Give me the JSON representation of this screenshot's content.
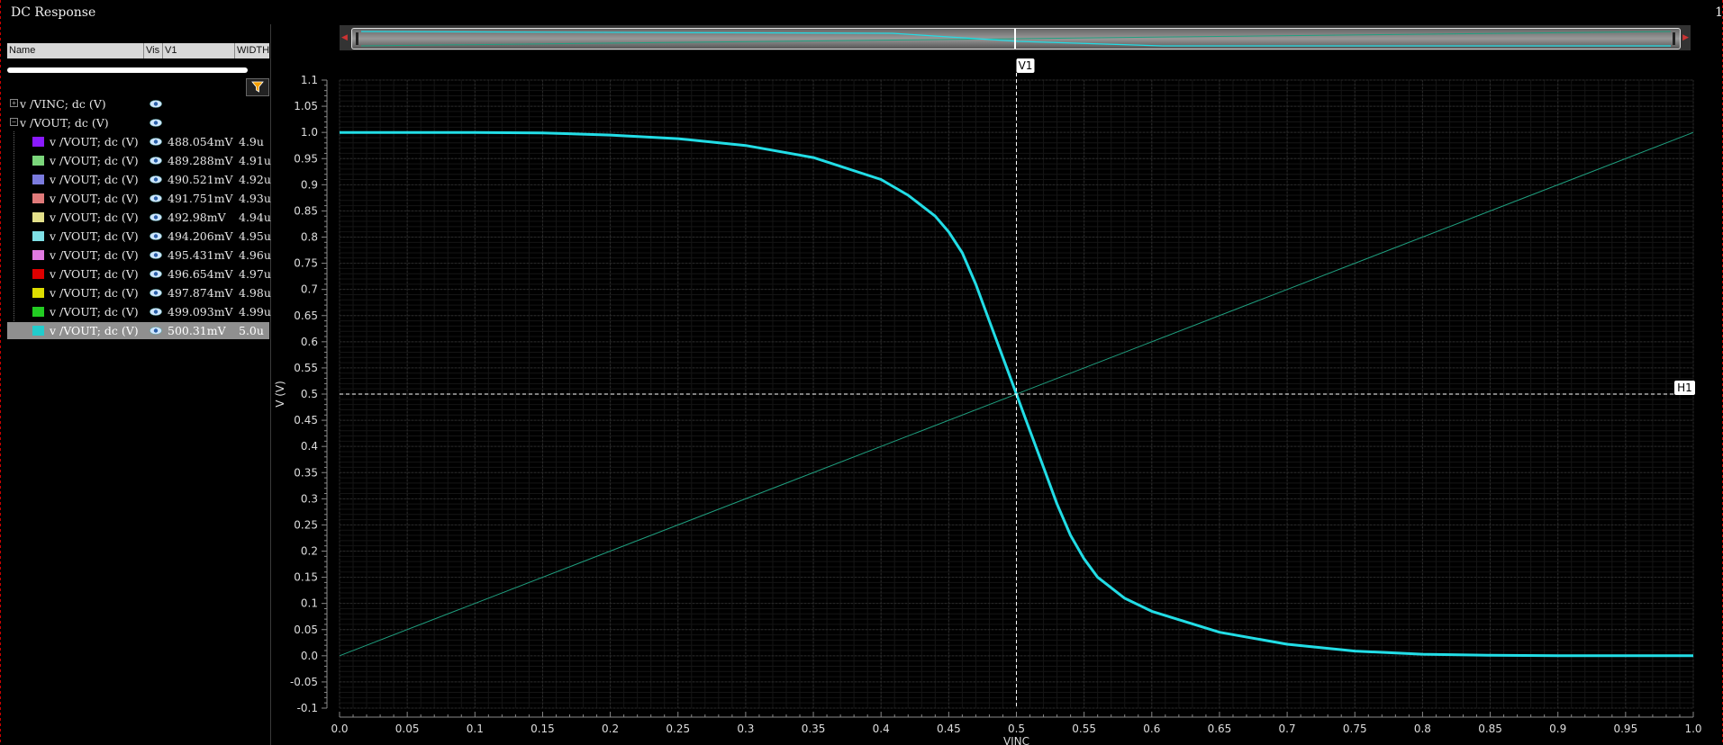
{
  "window": {
    "title": "DC Response",
    "page_num": "1"
  },
  "panel": {
    "columns": {
      "name": "Name",
      "vis": "Vis",
      "v1": "V1",
      "width": "WIDTH"
    },
    "groups": [
      {
        "label": "v /VINC; dc (V)",
        "expander": "+"
      },
      {
        "label": "v /VOUT; dc (V)",
        "expander": "−"
      }
    ],
    "signals": [
      {
        "label": "v /VOUT; dc (V)",
        "color": "#8a1aff",
        "v1": "488.054mV",
        "width": "4.9u"
      },
      {
        "label": "v /VOUT; dc (V)",
        "color": "#7bd67b",
        "v1": "489.288mV",
        "width": "4.91u"
      },
      {
        "label": "v /VOUT; dc (V)",
        "color": "#7b7bde",
        "v1": "490.521mV",
        "width": "4.92u"
      },
      {
        "label": "v /VOUT; dc (V)",
        "color": "#e07a7a",
        "v1": "491.751mV",
        "width": "4.93u"
      },
      {
        "label": "v /VOUT; dc (V)",
        "color": "#e3e08a",
        "v1": "492.98mV",
        "width": "4.94u"
      },
      {
        "label": "v /VOUT; dc (V)",
        "color": "#7fe0e6",
        "v1": "494.206mV",
        "width": "4.95u"
      },
      {
        "label": "v /VOUT; dc (V)",
        "color": "#e07ae0",
        "v1": "495.431mV",
        "width": "4.96u"
      },
      {
        "label": "v /VOUT; dc (V)",
        "color": "#dd0000",
        "v1": "496.654mV",
        "width": "4.97u"
      },
      {
        "label": "v /VOUT; dc (V)",
        "color": "#dddd00",
        "v1": "497.874mV",
        "width": "4.98u"
      },
      {
        "label": "v /VOUT; dc (V)",
        "color": "#22cc22",
        "v1": "499.093mV",
        "width": "4.99u"
      },
      {
        "label": "v /VOUT; dc (V)",
        "color": "#22cccc",
        "v1": "500.31mV",
        "width": "5.0u",
        "selected": true
      }
    ]
  },
  "cursors": {
    "vertical_label": "V1",
    "vertical_x": 0.5,
    "horizontal_label": "H1",
    "horizontal_y": 0.5
  },
  "chart_data": {
    "type": "line",
    "xlabel": "VINC",
    "ylabel": "V (V)",
    "xlim": [
      0.0,
      1.0
    ],
    "ylim": [
      -0.1,
      1.1
    ],
    "xticks": [
      "0.0",
      "0.05",
      "0.1",
      "0.15",
      "0.2",
      "0.25",
      "0.3",
      "0.35",
      "0.4",
      "0.45",
      "0.5",
      "0.55",
      "0.6",
      "0.65",
      "0.7",
      "0.75",
      "0.8",
      "0.85",
      "0.9",
      "0.95",
      "1.0"
    ],
    "yticks": [
      "1.1",
      "1.05",
      "1.0",
      "0.95",
      "0.9",
      "0.85",
      "0.8",
      "0.75",
      "0.7",
      "0.65",
      "0.6",
      "0.55",
      "0.5",
      "0.45",
      "0.4",
      "0.35",
      "0.3",
      "0.25",
      "0.2",
      "0.15",
      "0.1",
      "0.05",
      "0.0",
      "-0.05",
      "-0.1"
    ],
    "grid": true,
    "series": [
      {
        "color": "#1f9f7f",
        "x": [
          0.0,
          1.0
        ],
        "y": [
          0.0,
          1.0
        ]
      },
      {
        "color": "#22dde6",
        "x": [
          0.0,
          0.05,
          0.1,
          0.15,
          0.2,
          0.25,
          0.3,
          0.35,
          0.4,
          0.42,
          0.44,
          0.45,
          0.46,
          0.47,
          0.48,
          0.49,
          0.5,
          0.51,
          0.52,
          0.53,
          0.54,
          0.55,
          0.56,
          0.58,
          0.6,
          0.65,
          0.7,
          0.75,
          0.8,
          0.85,
          0.9,
          0.95,
          1.0
        ],
        "y": [
          1.0,
          1.0,
          1.0,
          0.999,
          0.995,
          0.988,
          0.975,
          0.952,
          0.91,
          0.88,
          0.84,
          0.81,
          0.77,
          0.71,
          0.64,
          0.57,
          0.5,
          0.43,
          0.36,
          0.29,
          0.23,
          0.185,
          0.15,
          0.11,
          0.085,
          0.045,
          0.022,
          0.009,
          0.003,
          0.001,
          0.0,
          0.0,
          0.0
        ]
      }
    ]
  }
}
